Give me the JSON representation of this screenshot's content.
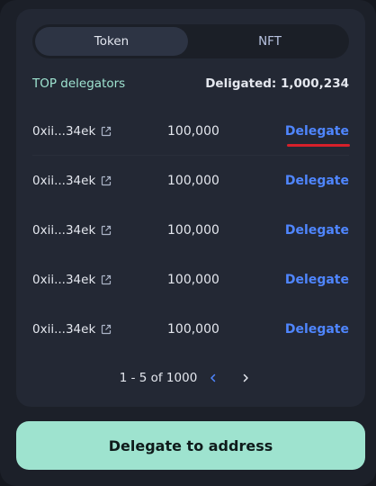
{
  "tabs": [
    "Token",
    "NFT"
  ],
  "list": {
    "header_label": "TOP delegators",
    "total_label": "Deligated: 1,000,234",
    "rows": [
      {
        "address": "0xii...34ek",
        "amount": "100,000",
        "action": "Delegate"
      },
      {
        "address": "0xii...34ek",
        "amount": "100,000",
        "action": "Delegate"
      },
      {
        "address": "0xii...34ek",
        "amount": "100,000",
        "action": "Delegate"
      },
      {
        "address": "0xii...34ek",
        "amount": "100,000",
        "action": "Delegate"
      },
      {
        "address": "0xii...34ek",
        "amount": "100,000",
        "action": "Delegate"
      }
    ]
  },
  "pagination": {
    "range": "1 - 5 of 1000"
  },
  "cta": {
    "label": "Delegate to address"
  },
  "icons": {
    "external_link": "external-link-icon",
    "prev": "chevron-left-icon",
    "next": "chevron-right-icon"
  },
  "colors": {
    "accent": "#9ee3cf",
    "link": "#4f86ff",
    "highlight_underline": "#d6202a",
    "card": "#232834"
  }
}
